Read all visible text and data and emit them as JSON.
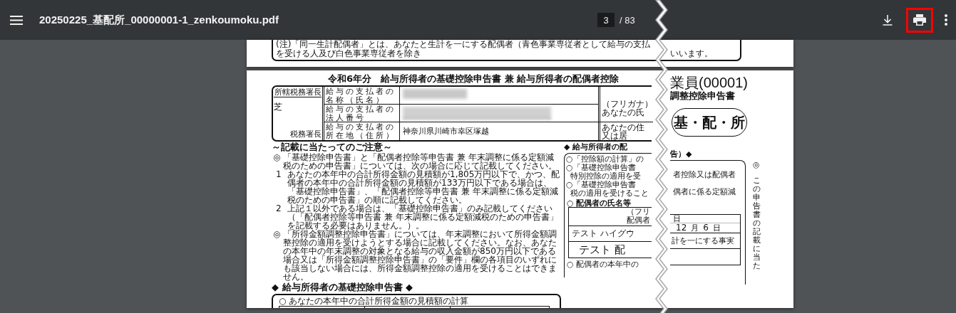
{
  "toolbar": {
    "title": "20250225_基配所_00000001-1_zenkoumoku.pdf",
    "page_current": "3",
    "page_total": "/ 83",
    "print_highlighted": true
  },
  "page_top": {
    "note_left": "(注)「同一生計配偶者」とは、あなたと生計を一にする配偶者（青色事業専従者として給与の支払を受ける人及び白色事業専従者を除き",
    "note_right": "いいます。"
  },
  "page_main": {
    "title_left": "令和6年分　給与所得者の基礎控除申告書 兼 給与所得者の配偶者控除",
    "employee_tag": "業員(00001)",
    "title_right": "調整控除申告書",
    "form_badge": "基・配・所",
    "office": {
      "label": "所轄税務署長",
      "name": "芝",
      "suffix": "税務署長"
    },
    "payer_rows": [
      {
        "label": "給与の支払者の名称（氏名）",
        "kind": "blurred"
      },
      {
        "label": "給与の支払者の法人番号",
        "kind": "digits_blurred"
      },
      {
        "label": "給与の支払者の所在地（住所）",
        "kind": "text",
        "value": "神奈川県川崎市幸区塚越"
      }
    ],
    "employee_labels": [
      {
        "lines": [
          "（フリガナ）",
          "あなたの氏"
        ]
      },
      {
        "lines": [
          "あなたの住",
          "又は居"
        ]
      }
    ],
    "notes_heading": "～記載に当たってのご注意～",
    "notes": [
      {
        "mark": "◎",
        "text": "「基礎控除申告書」と「配偶者控除等申告書 兼 年末調整に係る定額減税のための申告書」については、次の場合に応じて記載してください。"
      },
      {
        "mark": "1",
        "text": "あなたの本年中の合計所得金額の見積額が1,805万円以下で、かつ、配偶者の本年中の合計所得金額の見積額が133万円以下である場合は、「基礎控除申告書」、「配偶者控除等申告書 兼 年末調整に係る定額減税のための申告書」の順に記載してください。"
      },
      {
        "mark": "2",
        "text": "上記１以外である場合は、「基礎控除申告書」のみ記載してください（「配偶者控除等申告書 兼 年末調整に係る定額減税のための申告書」を記載する必要はありません。）。"
      },
      {
        "mark": "◎",
        "text": "「所得金額調整控除申告書」については、年末調整において所得金額調整控除の適用を受けようとする場合に記載してください。なお、あなたの本年中の年末調整の対象となる給与の収入金額が850万円以下である場合又は「所得金額調整控除申告書」の「要件」欄の各項目のいずれにも該当しない場合には、所得金額調整控除の適用を受けることはできません。"
      }
    ],
    "section_heading": "◆ 給与所得者の基礎控除申告書 ◆",
    "calc_label": "○ あなたの本年中の合計所得金額の見積額の計算",
    "spouse": {
      "heading_left": "◆ 給与所得者の配",
      "heading_right": "告）◆",
      "lines": [
        {
          "left": "○「控除額の計算」の",
          "indent": false
        },
        {
          "left": "○「基礎控除申告書",
          "right": "者控除又は配偶者",
          "indent": false
        },
        {
          "left": "特別控除の適用を受",
          "indent": true
        },
        {
          "left": "○「基礎控除申告書",
          "right": "偶者に係る定額減",
          "indent": false
        },
        {
          "left": "税の適用を受けること",
          "indent": true
        }
      ],
      "name_section": "○ 配偶者の氏名等",
      "furigana": "（フリ",
      "spouse_label": "配偶者",
      "date_top": "日",
      "month_value": "12",
      "month_unit": "月",
      "day_value": "6",
      "day_unit": "日",
      "kana_name": "テスト ハイグウ",
      "fact_label": "計を一にする事実",
      "name": "テスト 配",
      "income_line": "○ 配偶者の本年中の"
    },
    "side_mark": "◎",
    "side_vertical": "この申告書の記載に当た"
  }
}
